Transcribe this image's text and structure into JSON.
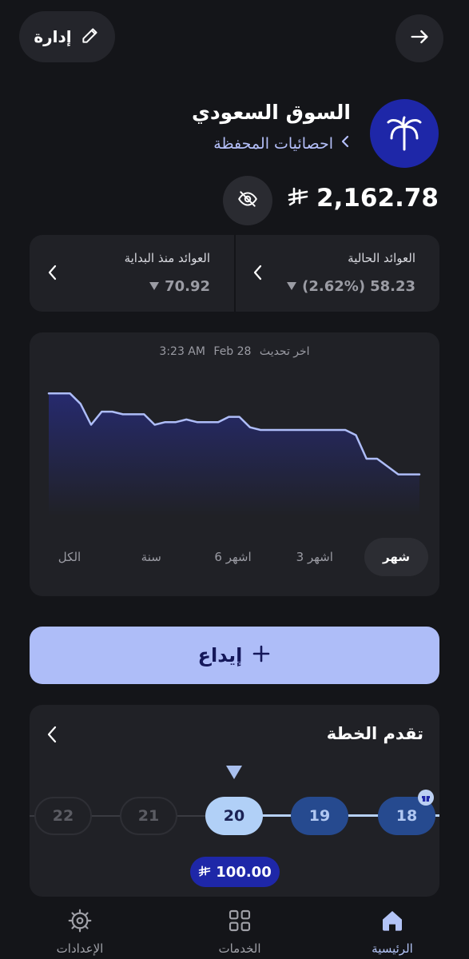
{
  "header": {
    "manage_label": "إدارة"
  },
  "portfolio": {
    "title": "السوق السعودي",
    "stats_link": "احصائيات المحفظة",
    "balance": "2,162.78",
    "currency_icon": "riyal-icon"
  },
  "returns": {
    "current": {
      "label": "العوائد الحالية",
      "value": "58.23",
      "percent": "(2.62%)",
      "trend": "down"
    },
    "since_start": {
      "label": "العوائد منذ البداية",
      "value": "70.92",
      "trend": "down"
    }
  },
  "chart_card": {
    "last_update_label": "اخر تحديث",
    "last_update_date": "Feb 28",
    "last_update_time": "3:23 AM",
    "ranges": [
      "شهر",
      "3 اشهر",
      "6 اشهر",
      "سنة",
      "الكل"
    ],
    "active_range": "شهر"
  },
  "chart_data": {
    "type": "area",
    "title": "",
    "xlabel": "",
    "ylabel": "",
    "x": [
      1,
      2,
      3,
      4,
      5,
      6,
      7,
      8,
      9,
      10,
      11,
      12,
      13,
      14,
      15,
      16,
      17,
      18,
      19,
      20,
      21,
      22,
      23,
      24,
      25,
      26,
      27,
      28,
      29,
      30,
      31,
      32,
      33,
      34,
      35,
      36
    ],
    "values": [
      2212,
      2212,
      2212,
      2208,
      2200,
      2205,
      2205,
      2204,
      2204,
      2204,
      2200,
      2201,
      2201,
      2202,
      2201,
      2201,
      2201,
      2203,
      2203,
      2199,
      2198,
      2198,
      2198,
      2198,
      2198,
      2198,
      2198,
      2198,
      2198,
      2196,
      2187,
      2187,
      2184,
      2181,
      2181,
      2181
    ],
    "ylim": [
      2165,
      2220
    ],
    "grid": false,
    "color": "#aebdf8"
  },
  "deposit": {
    "label": "إيداع"
  },
  "plan": {
    "title": "تقدم الخطة",
    "steps": [
      {
        "label": "18",
        "state": "done"
      },
      {
        "label": "19",
        "state": "done"
      },
      {
        "label": "20",
        "state": "current"
      },
      {
        "label": "21",
        "state": "future"
      },
      {
        "label": "22",
        "state": "future"
      }
    ],
    "current_amount": "100.00"
  },
  "nav": {
    "home": "الرئيسية",
    "services": "الخدمات",
    "settings": "الإعدادات"
  },
  "colors": {
    "accent": "#aebdf8",
    "brand": "#1e27a8",
    "background": "#141519",
    "card": "#202126"
  }
}
